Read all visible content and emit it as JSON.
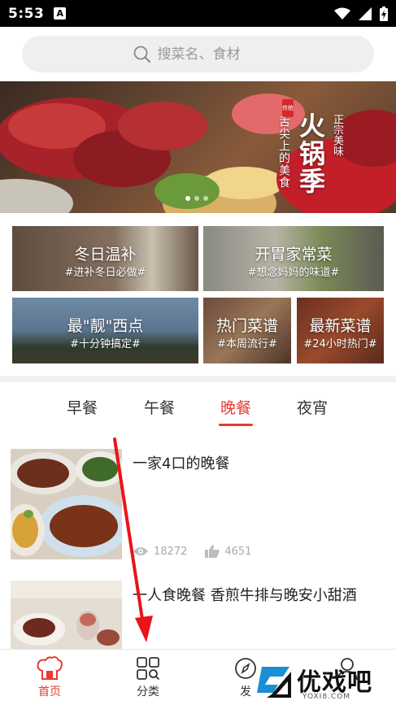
{
  "status_bar": {
    "time": "5:53",
    "notification_letter": "A"
  },
  "search": {
    "placeholder": "搜菜名、食材"
  },
  "banner": {
    "title": "火锅季",
    "subtitle": "舌尖上的美食",
    "tag": "正宗美味",
    "seal": "传统",
    "page_count": 3,
    "active_page": 0
  },
  "categories": [
    {
      "title": "冬日温补",
      "subtitle": "#进补冬日必做#"
    },
    {
      "title": "开胃家常菜",
      "subtitle": "#想念妈妈的味道#"
    },
    {
      "title": "最\"靓\"西点",
      "subtitle": "#十分钟搞定#"
    },
    {
      "title": "热门菜谱",
      "subtitle": "#本周流行#"
    },
    {
      "title": "最新菜谱",
      "subtitle": "#24小时热门#"
    }
  ],
  "meal_tabs": [
    {
      "label": "早餐",
      "active": false
    },
    {
      "label": "午餐",
      "active": false
    },
    {
      "label": "晚餐",
      "active": true
    },
    {
      "label": "夜宵",
      "active": false
    }
  ],
  "recipes": [
    {
      "title": "一家4口的晚餐",
      "views": "18272",
      "likes": "4651"
    },
    {
      "title": "一人食晚餐 香煎牛排与晚安小甜酒"
    }
  ],
  "bottom_nav": [
    {
      "label": "首页",
      "icon": "chef-hat-icon",
      "active": true
    },
    {
      "label": "分类",
      "icon": "grid-search-icon",
      "active": false
    },
    {
      "label": "发",
      "icon": "compass-icon",
      "active": false
    },
    {
      "label": "",
      "icon": "user-icon",
      "active": false
    }
  ],
  "watermark": {
    "text": "优戏吧",
    "url": "YOXI8.COM"
  },
  "colors": {
    "accent": "#e63b32",
    "search_bg": "#efefef",
    "annotation": "#e8141a"
  }
}
